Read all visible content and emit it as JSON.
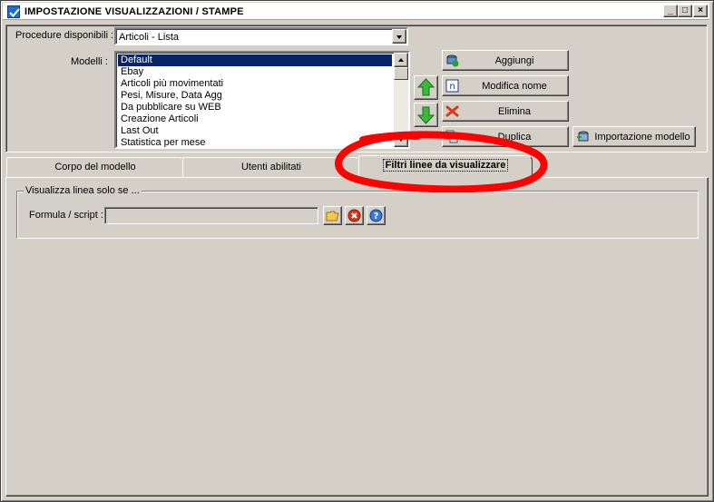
{
  "window": {
    "title": "IMPOSTAZIONE VISUALIZZAZIONI / STAMPE",
    "title_icon": "checkmark-icon",
    "controls": {
      "minimize": "_",
      "maximize": "□",
      "close": "×"
    }
  },
  "procedure": {
    "label": "Procedure disponibili :",
    "selected": "Articoli - Lista"
  },
  "modelli": {
    "label": "Modelli :",
    "items": [
      "Default",
      "Ebay",
      "Articoli più movimentati",
      "Pesi, Misure, Data Agg",
      "Da pubblicare su WEB",
      "Creazione Articoli",
      "Last Out",
      "Statistica per mese"
    ],
    "selected_index": 0
  },
  "buttons": {
    "aggiungi": "Aggiungi",
    "modifica_nome": "Modifica nome",
    "elimina": "Elimina",
    "duplica": "Duplica",
    "importazione": "Importazione modello"
  },
  "tabs": [
    {
      "label": "Corpo del modello",
      "active": false
    },
    {
      "label": "Utenti abilitati",
      "active": false
    },
    {
      "label": "Filtri linee da visualizzare",
      "active": true
    }
  ],
  "filter": {
    "group_title": "Visualizza linea solo se ...",
    "formula_label": "Formula / script :",
    "formula_value": ""
  },
  "colors": {
    "annotation": "#ff0000",
    "selection": "#0a246a",
    "face": "#d4d0c8"
  }
}
